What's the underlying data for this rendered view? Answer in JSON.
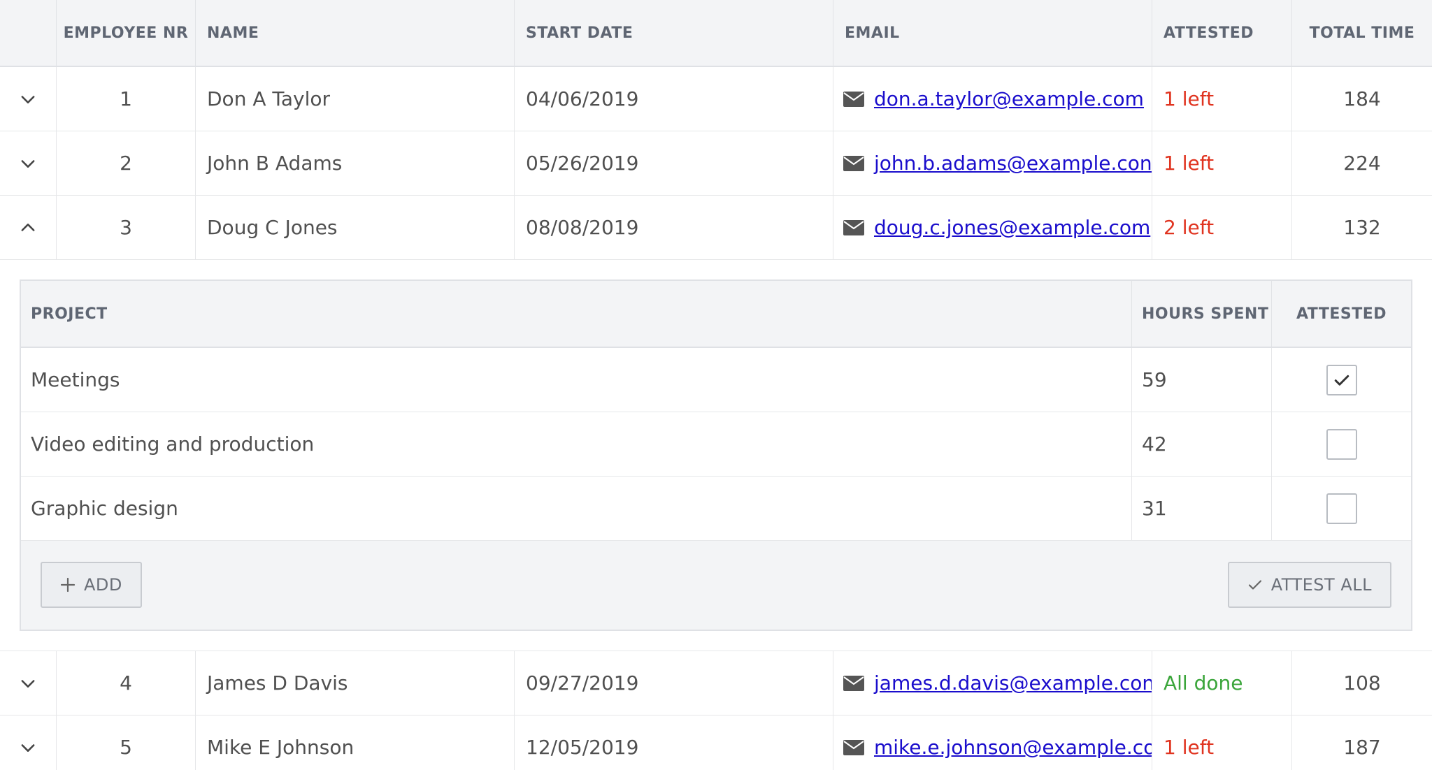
{
  "columns": {
    "employee_nr": "EMPLOYEE NR",
    "name": "NAME",
    "start_date": "START DATE",
    "email": "EMAIL",
    "attested": "ATTESTED",
    "total_time": "TOTAL TIME"
  },
  "employees": [
    {
      "nr": "1",
      "name": "Don A Taylor",
      "start_date": "04/06/2019",
      "email": "don.a.taylor@example.com",
      "attested": "1 left",
      "total_time": "184",
      "expanded": false
    },
    {
      "nr": "2",
      "name": "John B Adams",
      "start_date": "05/26/2019",
      "email": "john.b.adams@example.con",
      "attested": "1 left",
      "total_time": "224",
      "expanded": false
    },
    {
      "nr": "3",
      "name": "Doug C Jones",
      "start_date": "08/08/2019",
      "email": "doug.c.jones@example.com",
      "attested": "2 left",
      "total_time": "132",
      "expanded": true
    },
    {
      "nr": "4",
      "name": "James D Davis",
      "start_date": "09/27/2019",
      "email": "james.d.davis@example.con",
      "attested": "All done",
      "total_time": "108",
      "expanded": false
    },
    {
      "nr": "5",
      "name": "Mike E Johnson",
      "start_date": "12/05/2019",
      "email": "mike.e.johnson@example.co",
      "attested": "1 left",
      "total_time": "187",
      "expanded": false
    }
  ],
  "detail": {
    "columns": {
      "project": "PROJECT",
      "hours_spent": "HOURS SPENT",
      "attested": "ATTESTED"
    },
    "projects": [
      {
        "project": "Meetings",
        "hours": "59",
        "attested": true
      },
      {
        "project": "Video editing and production",
        "hours": "42",
        "attested": false
      },
      {
        "project": "Graphic design",
        "hours": "31",
        "attested": false
      }
    ],
    "add_label": "ADD",
    "attest_all_label": "ATTEST ALL"
  },
  "colors": {
    "status_pending": "#e0331f",
    "status_done": "#3aa53a",
    "link": "#1a0dcc"
  },
  "icons": {
    "collapsed": "chevron-down-icon",
    "expanded": "chevron-up-icon",
    "email": "envelope-icon",
    "checked": "checkmark-icon",
    "add": "plus-icon"
  }
}
